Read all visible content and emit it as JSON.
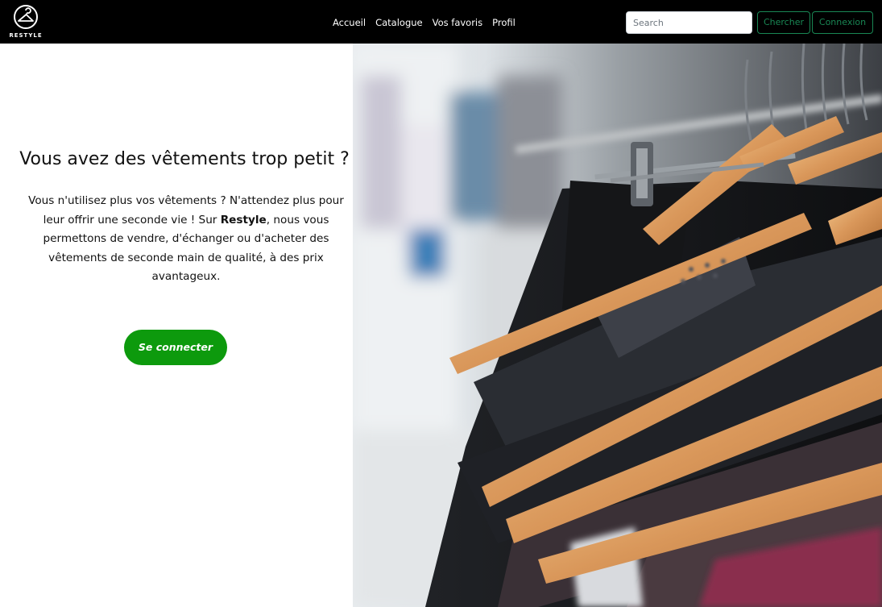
{
  "nav": {
    "brand": "RESTYLE",
    "links": [
      "Accueil",
      "Catalogue",
      "Vos favoris",
      "Profil"
    ],
    "search_placeholder": "Search",
    "search_button": "Chercher",
    "login_button": "Connexion"
  },
  "hero": {
    "title": "Vous avez des vêtements trop petit ?",
    "text_before": "Vous n'utilisez plus vos vêtements ? N'attendez plus pour leur offrir une seconde vie ! Sur ",
    "text_bold": "Restyle",
    "text_after": ", nous vous permettons de vendre, d'échanger ou d'acheter des vêtements de seconde main de qualité, à des prix avantageux.",
    "cta": "Se connecter"
  },
  "colors": {
    "navbar_bg": "#000000",
    "accent_green": "#198754",
    "cta_green": "#0d9a0d"
  },
  "image": {
    "subject": "clothes on wooden hangers on a rack"
  }
}
